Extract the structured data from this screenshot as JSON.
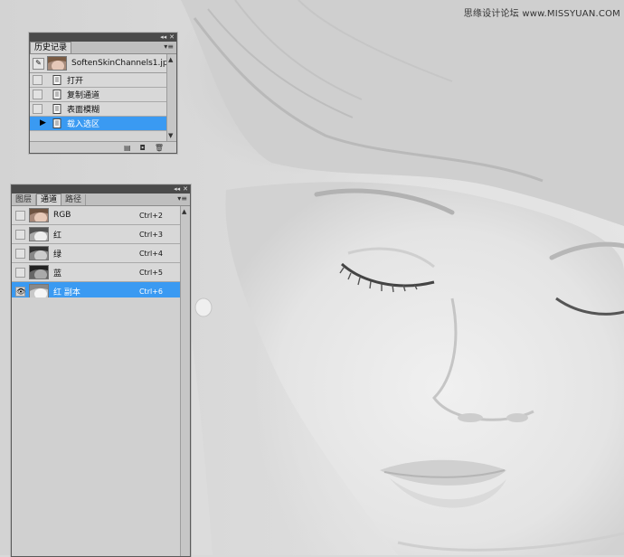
{
  "watermark": "思缘设计论坛 www.MISSYUAN.COM",
  "history_panel": {
    "tab_label": "历史记录",
    "snapshot_name": "SoftenSkinChannels1.jpg",
    "items": [
      {
        "label": "打开",
        "selected": false
      },
      {
        "label": "复制通道",
        "selected": false
      },
      {
        "label": "表面模糊",
        "selected": false
      },
      {
        "label": "载入选区",
        "selected": true
      }
    ],
    "footer_icons": [
      "new-document-from-state-icon",
      "create-snapshot-icon",
      "delete-icon"
    ]
  },
  "channels_panel": {
    "tabs": [
      "图层",
      "通道",
      "路径"
    ],
    "active_tab": "通道",
    "channels": [
      {
        "name": "RGB",
        "shortcut": "Ctrl+2",
        "visible": false,
        "selected": false
      },
      {
        "name": "红",
        "shortcut": "Ctrl+3",
        "visible": false,
        "selected": false
      },
      {
        "name": "绿",
        "shortcut": "Ctrl+4",
        "visible": false,
        "selected": false
      },
      {
        "name": "蓝",
        "shortcut": "Ctrl+5",
        "visible": false,
        "selected": false
      },
      {
        "name": "红 副本",
        "shortcut": "Ctrl+6",
        "visible": true,
        "selected": true
      }
    ]
  },
  "colors": {
    "selection": "#3a9af2",
    "panel_bg": "#d4d4d4",
    "titlebar": "#4a4a4a"
  }
}
